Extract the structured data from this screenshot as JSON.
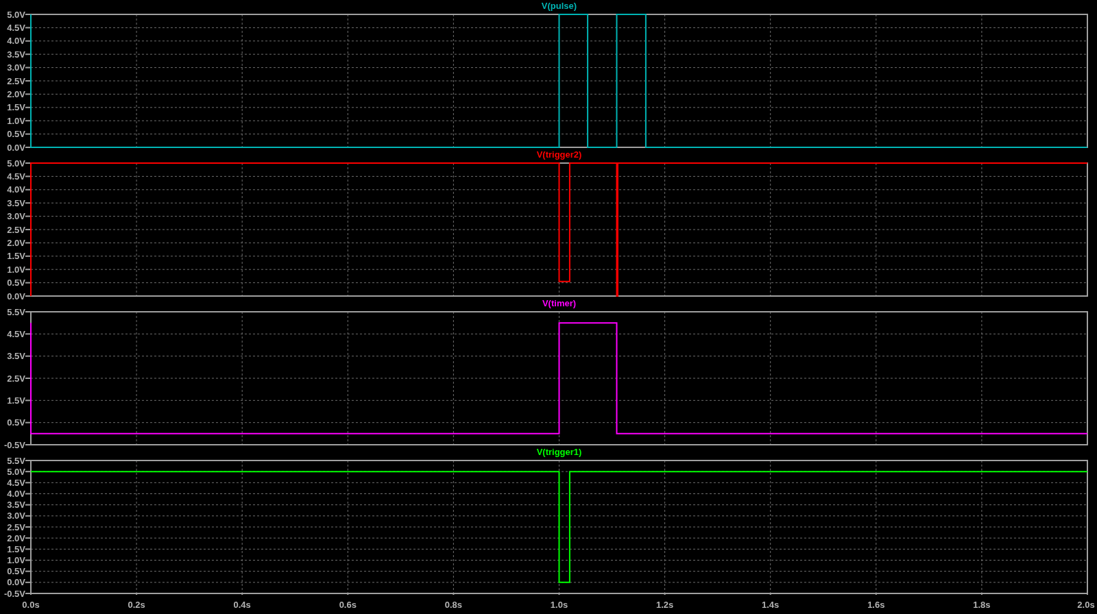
{
  "charts": [
    {
      "chart_data": {
        "type": "line",
        "grid": true,
        "title": "V(pulse)",
        "xlim": [
          0,
          2
        ],
        "ylim": [
          0,
          5
        ],
        "yticks": [
          {
            "value": 0,
            "label": "0.0V"
          },
          {
            "value": 0.5,
            "label": "0.5V"
          },
          {
            "value": 1,
            "label": "1.0V"
          },
          {
            "value": 1.5,
            "label": "1.5V"
          },
          {
            "value": 2,
            "label": "2.0V"
          },
          {
            "value": 2.5,
            "label": "2.5V"
          },
          {
            "value": 3,
            "label": "3.0V"
          },
          {
            "value": 3.5,
            "label": "3.5V"
          },
          {
            "value": 4,
            "label": "4.0V"
          },
          {
            "value": 4.5,
            "label": "4.5V"
          },
          {
            "value": 5,
            "label": "5.0V"
          }
        ],
        "x": [
          0,
          0,
          1.0,
          1.0,
          1.054,
          1.054,
          1.109,
          1.109,
          1.164,
          1.164,
          2
        ],
        "series": [
          {
            "color": "#00b4b4",
            "values": [
              5,
              0,
              0,
              5,
              5,
              0,
              0,
              5,
              5,
              0,
              0
            ]
          }
        ]
      }
    },
    {
      "chart_data": {
        "type": "line",
        "grid": true,
        "title": "V(trigger2)",
        "xlim": [
          0,
          2
        ],
        "ylim": [
          0,
          5
        ],
        "yticks": [
          {
            "value": 0,
            "label": "0.0V"
          },
          {
            "value": 0.5,
            "label": "0.5V"
          },
          {
            "value": 1,
            "label": "1.0V"
          },
          {
            "value": 1.5,
            "label": "1.5V"
          },
          {
            "value": 2,
            "label": "2.0V"
          },
          {
            "value": 2.5,
            "label": "2.5V"
          },
          {
            "value": 3,
            "label": "3.0V"
          },
          {
            "value": 3.5,
            "label": "3.5V"
          },
          {
            "value": 4,
            "label": "4.0V"
          },
          {
            "value": 4.5,
            "label": "4.5V"
          },
          {
            "value": 5,
            "label": "5.0V"
          }
        ],
        "x": [
          0,
          0,
          1.0,
          1.0,
          1.02,
          1.02,
          1.109,
          1.109,
          1.111,
          1.111,
          2
        ],
        "series": [
          {
            "color": "#ff0000",
            "values": [
              0,
              5,
              5,
              0.55,
              0.55,
              5,
              5,
              0,
              0,
              5,
              5
            ]
          }
        ]
      }
    },
    {
      "chart_data": {
        "type": "line",
        "grid": true,
        "title": "V(timer)",
        "xlim": [
          0,
          2
        ],
        "ylim": [
          -0.5,
          5.5
        ],
        "yticks": [
          {
            "value": -0.5,
            "label": "-0.5V"
          },
          {
            "value": 0.5,
            "label": "0.5V"
          },
          {
            "value": 1.5,
            "label": "1.5V"
          },
          {
            "value": 2.5,
            "label": "2.5V"
          },
          {
            "value": 3.5,
            "label": "3.5V"
          },
          {
            "value": 4.5,
            "label": "4.5V"
          },
          {
            "value": 5.5,
            "label": "5.5V"
          }
        ],
        "x": [
          0,
          0,
          1.0,
          1.0,
          1.109,
          1.109,
          2
        ],
        "series": [
          {
            "color": "#ff00ff",
            "values": [
              5,
              0,
              0,
              5,
              5,
              0,
              0
            ]
          }
        ]
      }
    },
    {
      "chart_data": {
        "type": "line",
        "grid": true,
        "title": "V(trigger1)",
        "xlim": [
          0,
          2
        ],
        "ylim": [
          -0.5,
          5.5
        ],
        "yticks": [
          {
            "value": -0.5,
            "label": "-0.5V"
          },
          {
            "value": 0,
            "label": "0.0V"
          },
          {
            "value": 0.5,
            "label": "0.5V"
          },
          {
            "value": 1,
            "label": "1.0V"
          },
          {
            "value": 1.5,
            "label": "1.5V"
          },
          {
            "value": 2,
            "label": "2.0V"
          },
          {
            "value": 2.5,
            "label": "2.5V"
          },
          {
            "value": 3,
            "label": "3.0V"
          },
          {
            "value": 3.5,
            "label": "3.5V"
          },
          {
            "value": 4,
            "label": "4.0V"
          },
          {
            "value": 4.5,
            "label": "4.5V"
          },
          {
            "value": 5,
            "label": "5.0V"
          },
          {
            "value": 5.5,
            "label": "5.5V"
          }
        ],
        "xticks": [
          {
            "value": 0,
            "label": "0.0s"
          },
          {
            "value": 0.2,
            "label": "0.2s"
          },
          {
            "value": 0.4,
            "label": "0.4s"
          },
          {
            "value": 0.6,
            "label": "0.6s"
          },
          {
            "value": 0.8,
            "label": "0.8s"
          },
          {
            "value": 1,
            "label": "1.0s"
          },
          {
            "value": 1.2,
            "label": "1.2s"
          },
          {
            "value": 1.4,
            "label": "1.4s"
          },
          {
            "value": 1.6,
            "label": "1.6s"
          },
          {
            "value": 1.8,
            "label": "1.8s"
          },
          {
            "value": 2,
            "label": "2.0s"
          }
        ],
        "x": [
          0,
          1.0,
          1.0,
          1.02,
          1.02,
          2
        ],
        "series": [
          {
            "color": "#00ff00",
            "values": [
              5,
              5,
              0,
              0,
              5,
              5
            ]
          }
        ]
      }
    }
  ]
}
